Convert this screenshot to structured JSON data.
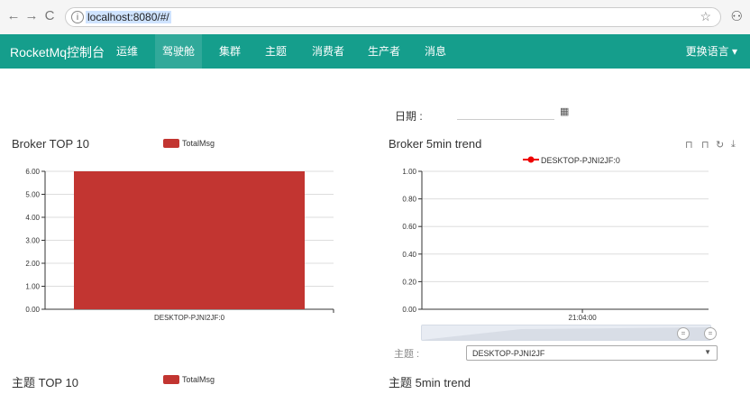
{
  "browser": {
    "url": "localhost:8080/#/",
    "back_icon": "back-arrow-icon",
    "forward_icon": "forward-arrow-icon",
    "reload_icon": "reload-icon"
  },
  "navbar": {
    "brand": "RocketMq控制台",
    "items": [
      {
        "label": "运维"
      },
      {
        "label": "驾驶舱"
      },
      {
        "label": "集群"
      },
      {
        "label": "主题"
      },
      {
        "label": "消费者"
      },
      {
        "label": "生产者"
      },
      {
        "label": "消息"
      }
    ],
    "active_index": 1,
    "lang_label": "更换语言 ▾",
    "bg_color": "#159e8c"
  },
  "date_filter": {
    "label": "日期 :",
    "value": ""
  },
  "broker_top10": {
    "title": "Broker TOP 10",
    "legend": "TotalMsg",
    "color": "#c23531",
    "chart_data": {
      "type": "bar",
      "categories": [
        "DESKTOP-PJNI2JF:0"
      ],
      "series": [
        {
          "name": "TotalMsg",
          "values": [
            6
          ]
        }
      ],
      "ylim": [
        0,
        6
      ],
      "yticks": [
        "6.00",
        "5.00",
        "4.00",
        "3.00",
        "2.00",
        "1.00",
        "0.00"
      ]
    }
  },
  "broker_trend": {
    "title": "Broker 5min trend",
    "legend": "DESKTOP-PJNI2JF:0",
    "chart_data": {
      "type": "line",
      "x": [
        "21:04:00"
      ],
      "series": [
        {
          "name": "DESKTOP-PJNI2JF:0",
          "values": []
        }
      ],
      "ylim": [
        0,
        1
      ],
      "yticks": [
        "1.00",
        "0.80",
        "0.60",
        "0.40",
        "0.20",
        "0.00"
      ]
    }
  },
  "topic_select": {
    "label": "主题 :",
    "value": "DESKTOP-PJNI2JF"
  },
  "topic_top10": {
    "title": "主题 TOP 10",
    "legend": "TotalMsg"
  },
  "topic_trend": {
    "title": "主题 5min trend"
  }
}
